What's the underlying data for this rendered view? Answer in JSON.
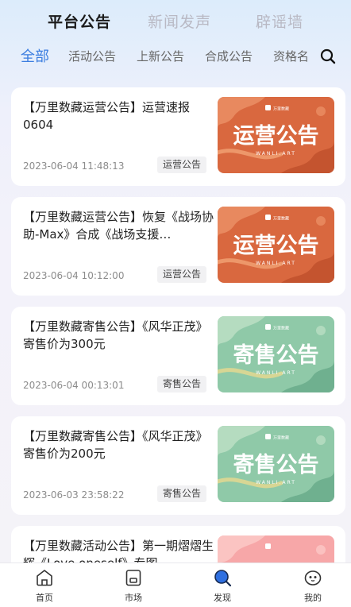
{
  "top_tabs": [
    {
      "label": "平台公告",
      "active": true
    },
    {
      "label": "新闻发声",
      "active": false
    },
    {
      "label": "辟谣墙",
      "active": false
    }
  ],
  "sub_tabs": [
    {
      "label": "全部",
      "active": true
    },
    {
      "label": "活动公告",
      "active": false
    },
    {
      "label": "上新公告",
      "active": false
    },
    {
      "label": "合成公告",
      "active": false
    },
    {
      "label": "资格名",
      "active": false
    }
  ],
  "search_icon": "search-icon",
  "announcements": [
    {
      "title": "【万里数藏运营公告】运营速报0604",
      "time": "2023-06-04 11:48:13",
      "category": "运营公告",
      "thumb_text": "运营公告",
      "thumb_theme": "orange"
    },
    {
      "title": "【万里数藏运营公告】恢复《战场协助-Max》合成《战场支援…",
      "time": "2023-06-04 10:12:00",
      "category": "运营公告",
      "thumb_text": "运营公告",
      "thumb_theme": "orange"
    },
    {
      "title": "【万里数藏寄售公告】《风华正茂》寄售价为300元",
      "time": "2023-06-04 00:13:01",
      "category": "寄售公告",
      "thumb_text": "寄售公告",
      "thumb_theme": "green"
    },
    {
      "title": "【万里数藏寄售公告】《风华正茂》寄售价为200元",
      "time": "2023-06-03 23:58:22",
      "category": "寄售公告",
      "thumb_text": "寄售公告",
      "thumb_theme": "green"
    },
    {
      "title": "【万里数藏活动公告】第一期熠熠生辉《Love oneself》专图",
      "time": "",
      "category": "",
      "thumb_text": "",
      "thumb_theme": "pink"
    }
  ],
  "thumb_brand": "WANLI.ART",
  "thumb_logo_text": "万里数藏",
  "bottom_nav": [
    {
      "label": "首页",
      "icon": "home-icon",
      "active": false
    },
    {
      "label": "市场",
      "icon": "market-icon",
      "active": false
    },
    {
      "label": "发现",
      "icon": "discover-icon",
      "active": true
    },
    {
      "label": "我的",
      "icon": "profile-icon",
      "active": false
    }
  ],
  "colors": {
    "accent": "#3b7de0",
    "orange_thumb": "#d9683f",
    "green_thumb": "#8fc9a8",
    "pink_thumb": "#f7a7a8"
  }
}
